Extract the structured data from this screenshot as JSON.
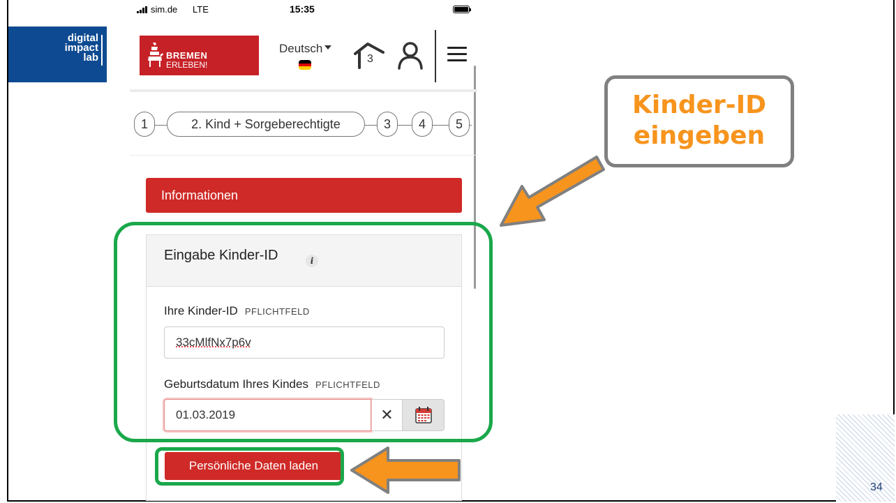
{
  "slide": {
    "logo_line1": "digital",
    "logo_line2": "impact",
    "logo_line3": "lab",
    "page_number": "34"
  },
  "status_bar": {
    "carrier": "sim.de",
    "network": "LTE",
    "time": "15:35"
  },
  "header": {
    "brand_line1": "BREMEN",
    "brand_line2": "ERLEBEN!",
    "language": "Deutsch",
    "home_count": "3"
  },
  "stepper": {
    "steps": [
      "1",
      "2. Kind + Sorgeberechtigte",
      "3",
      "4",
      "5"
    ],
    "active_step": 2
  },
  "info_button": {
    "label": "Informationen"
  },
  "card": {
    "title": "Eingabe Kinder-ID",
    "info_icon": "i",
    "kid_label": "Ihre Kinder-ID",
    "kid_required": "PFLICHTFELD",
    "kid_value": "33cMlfNx7p6v",
    "dob_label": "Geburtsdatum Ihres Kindes",
    "dob_required": "PFLICHTFELD",
    "dob_value": "01.03.2019",
    "clear_symbol": "✕",
    "load_button": "Persönliche Daten laden"
  },
  "callout": {
    "line1": "Kinder-ID",
    "line2": "eingeben"
  },
  "colors": {
    "brand_red": "#c62127",
    "highlight_green": "#1aa84a",
    "arrow_orange": "#f7941d",
    "logo_blue": "#0e4a91"
  },
  "icons": [
    "house-icon",
    "user-icon",
    "menu-icon",
    "calendar-icon",
    "info-icon",
    "clear-icon",
    "german-flag-icon",
    "caret-down-icon"
  ]
}
